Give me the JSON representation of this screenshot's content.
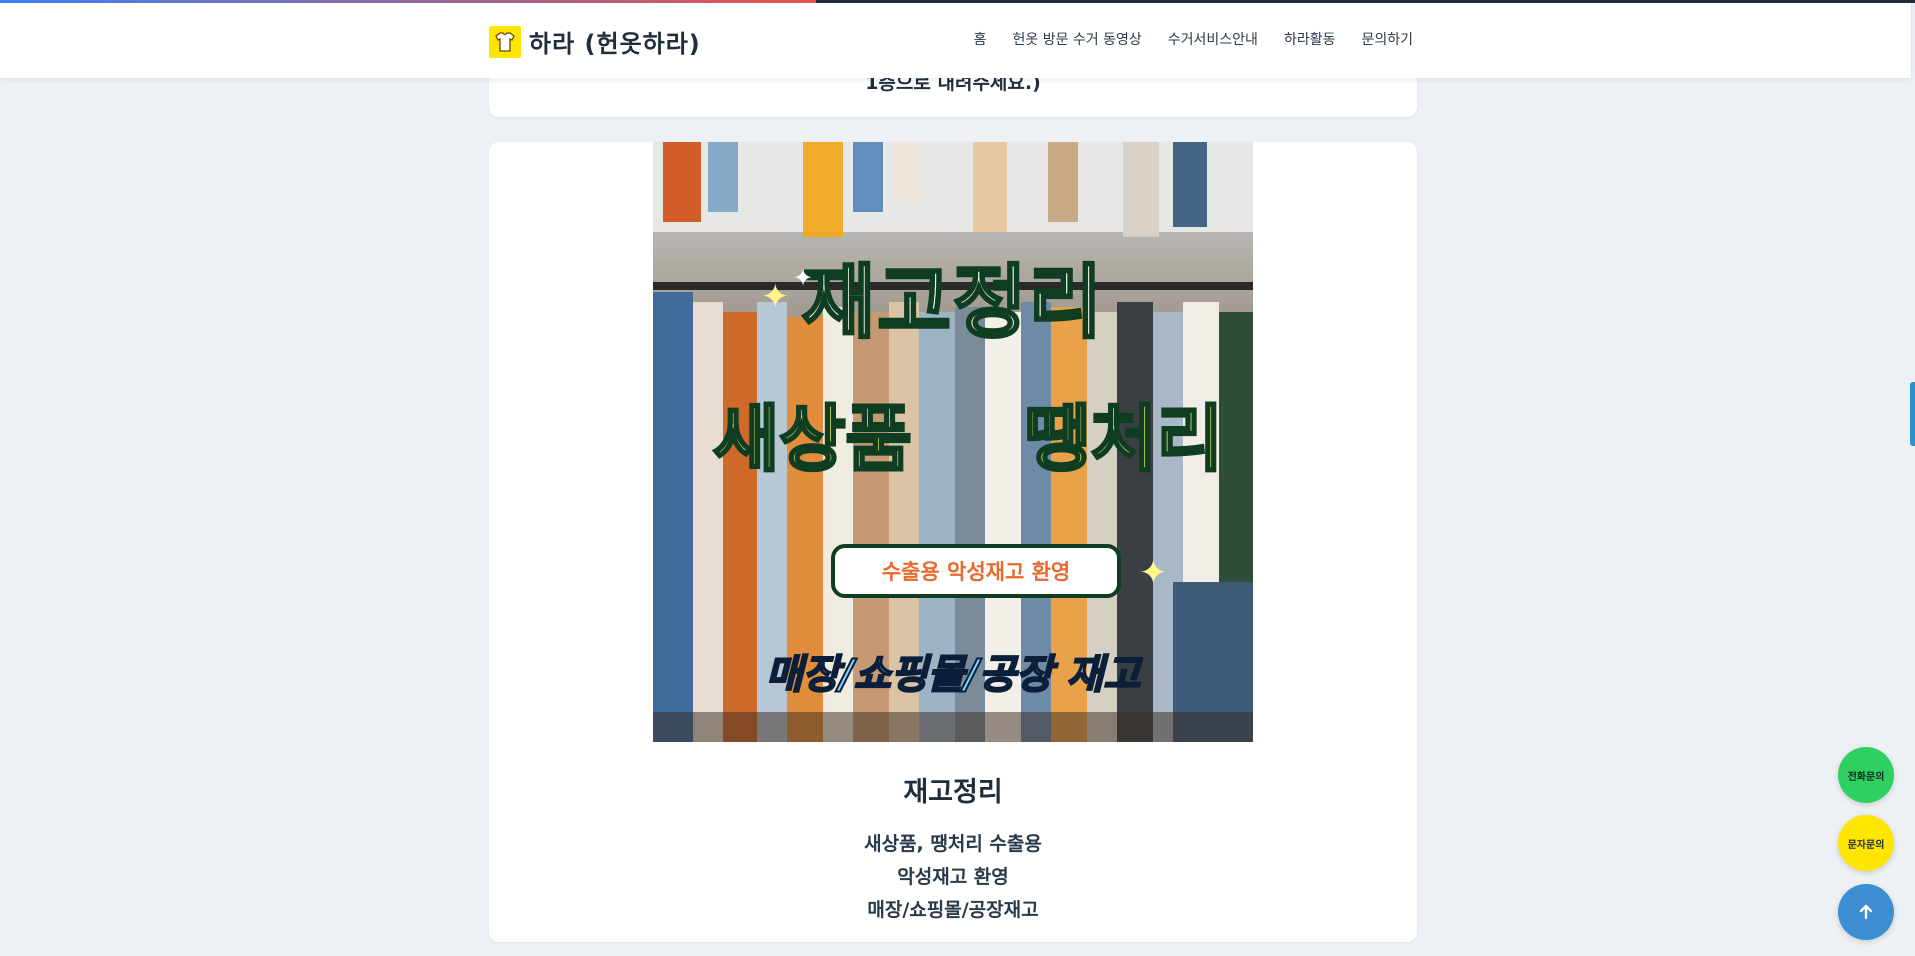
{
  "header": {
    "logo_text": "하라 (헌옷하라)",
    "nav": [
      "홈",
      "헌옷 방문 수거 동영상",
      "수거서비스안내",
      "하라활동",
      "문의하기"
    ]
  },
  "page_progress_percent": 42.6,
  "previous_card": {
    "partial_text": "1층으로 내려주세요.)"
  },
  "card": {
    "image": {
      "headline": "재고정리",
      "line2_left": "새상품",
      "line2_right": "땡처리",
      "pill": "수출용 악성재고 환영",
      "bottom": "매장/쇼핑몰/공장 재고"
    },
    "title": "재고정리",
    "description": [
      "새상품, 땡처리 수출용",
      "악성재고 환영",
      "매장/쇼핑몰/공장재고"
    ]
  },
  "floating_buttons": {
    "call": "전화문의",
    "sms": "문자문의",
    "top_icon": "arrow-up-icon"
  },
  "colors": {
    "accent_yellow": "#ffe600",
    "call_green": "#2fcf62",
    "top_blue": "#3d8fd1"
  }
}
